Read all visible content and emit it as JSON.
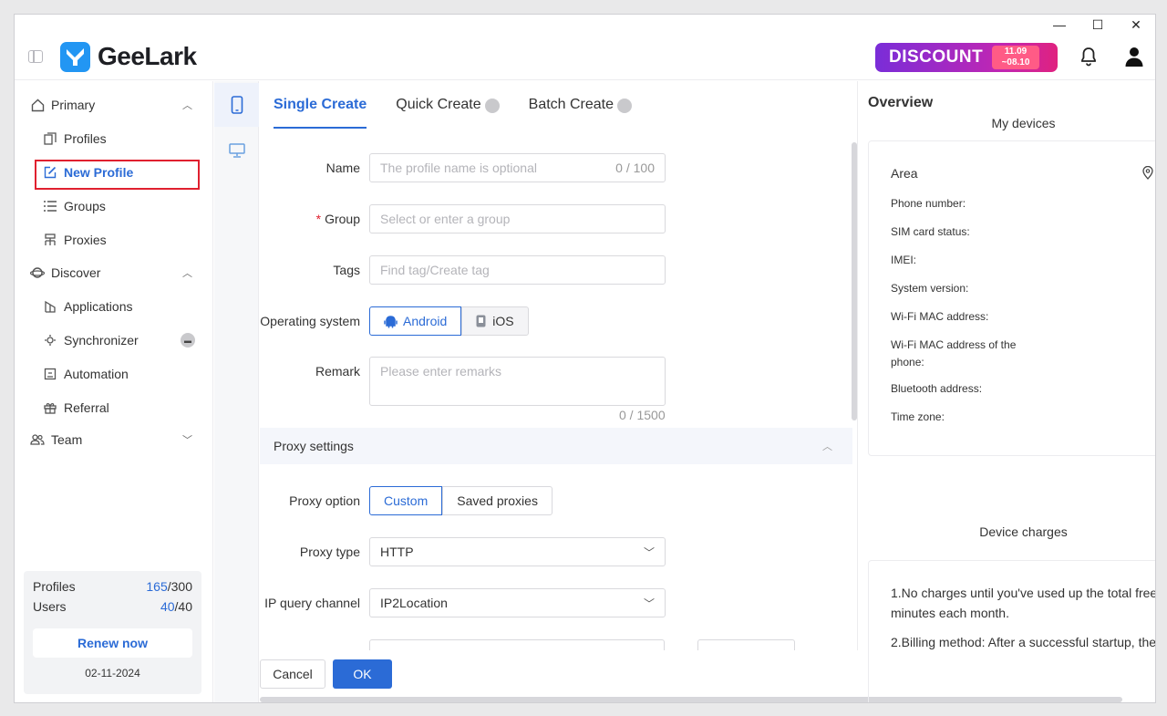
{
  "window": {
    "minimize": "—",
    "maximize": "☐",
    "close": "✕"
  },
  "header": {
    "brand": "GeeLark",
    "discount_label": "DISCOUNT",
    "discount_dates": [
      "11.09",
      "~08.10"
    ]
  },
  "sidebar": {
    "primary": {
      "label": "Primary",
      "items": [
        "Profiles",
        "New Profile",
        "Groups",
        "Proxies"
      ]
    },
    "discover": {
      "label": "Discover",
      "items": [
        "Applications",
        "Synchronizer",
        "Automation",
        "Referral"
      ]
    },
    "team": {
      "label": "Team"
    },
    "stats": {
      "profiles_label": "Profiles",
      "profiles_used": "165",
      "profiles_total": "/300",
      "users_label": "Users",
      "users_used": "40",
      "users_total": "/40",
      "renew": "Renew now",
      "date": "02-11-2024"
    }
  },
  "tabs": [
    "Single Create",
    "Quick Create",
    "Batch Create"
  ],
  "form": {
    "name": {
      "label": "Name",
      "placeholder": "The profile name is optional",
      "counter": "0 / 100"
    },
    "group": {
      "required_mark": "*",
      "label": "Group",
      "placeholder": "Select or enter a group"
    },
    "tags": {
      "label": "Tags",
      "placeholder": "Find tag/Create tag"
    },
    "os": {
      "label": "Operating system",
      "options": [
        "Android",
        "iOS"
      ],
      "selected": "Android"
    },
    "remark": {
      "label": "Remark",
      "placeholder": "Please enter remarks",
      "counter": "0 / 1500"
    },
    "proxy_section": "Proxy settings",
    "proxy_option": {
      "label": "Proxy option",
      "options": [
        "Custom",
        "Saved proxies"
      ],
      "selected": "Custom"
    },
    "proxy_type": {
      "label": "Proxy type",
      "value": "HTTP"
    },
    "ip_channel": {
      "label": "IP query channel",
      "value": "IP2Location"
    }
  },
  "footer": {
    "cancel": "Cancel",
    "ok": "OK"
  },
  "overview": {
    "title": "Overview",
    "my_devices": "My devices",
    "area": "Area",
    "fields": [
      "Phone number:",
      "SIM card status:",
      "IMEI:",
      "System version:",
      "Wi-Fi MAC address:",
      "Wi-Fi MAC address of the phone:",
      "Bluetooth address:",
      "Time zone:"
    ],
    "charges_title": "Device charges",
    "charges": [
      "1.No charges until you've used up the total free minutes each month.",
      "2.Billing method: After a successful startup, the"
    ]
  },
  "colors": {
    "accent": "#2b6bd6",
    "highlight": "#e0202f",
    "brand": "#2296f3"
  }
}
